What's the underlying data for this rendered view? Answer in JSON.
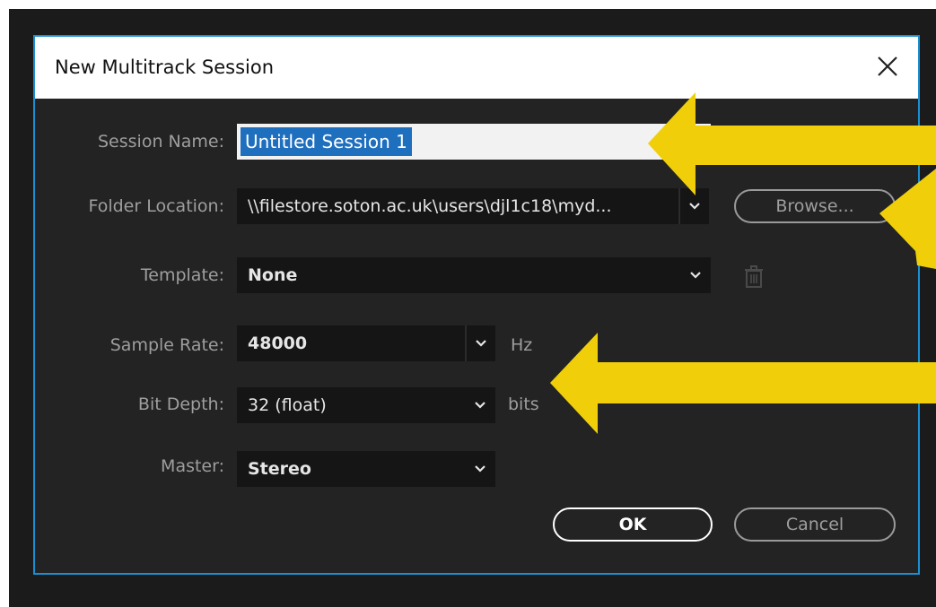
{
  "dialog": {
    "title": "New Multitrack Session",
    "accent_color": "#1a8fd3"
  },
  "fields": {
    "session_name": {
      "label": "Session Name:",
      "value": "Untitled Session 1"
    },
    "folder_location": {
      "label": "Folder Location:",
      "value": "\\\\filestore.soton.ac.uk\\users\\djl1c18\\myd..."
    },
    "template": {
      "label": "Template:",
      "value": "None"
    },
    "sample_rate": {
      "label": "Sample Rate:",
      "value": "48000",
      "unit": "Hz"
    },
    "bit_depth": {
      "label": "Bit Depth:",
      "value": "32 (float)",
      "unit": "bits"
    },
    "master": {
      "label": "Master:",
      "value": "Stereo"
    }
  },
  "buttons": {
    "browse": "Browse...",
    "ok": "OK",
    "cancel": "Cancel"
  },
  "icons": {
    "close": "close-icon",
    "chevron": "chevron-down-icon",
    "trash": "trash-icon"
  },
  "annotation_color": "#f0cf0a"
}
